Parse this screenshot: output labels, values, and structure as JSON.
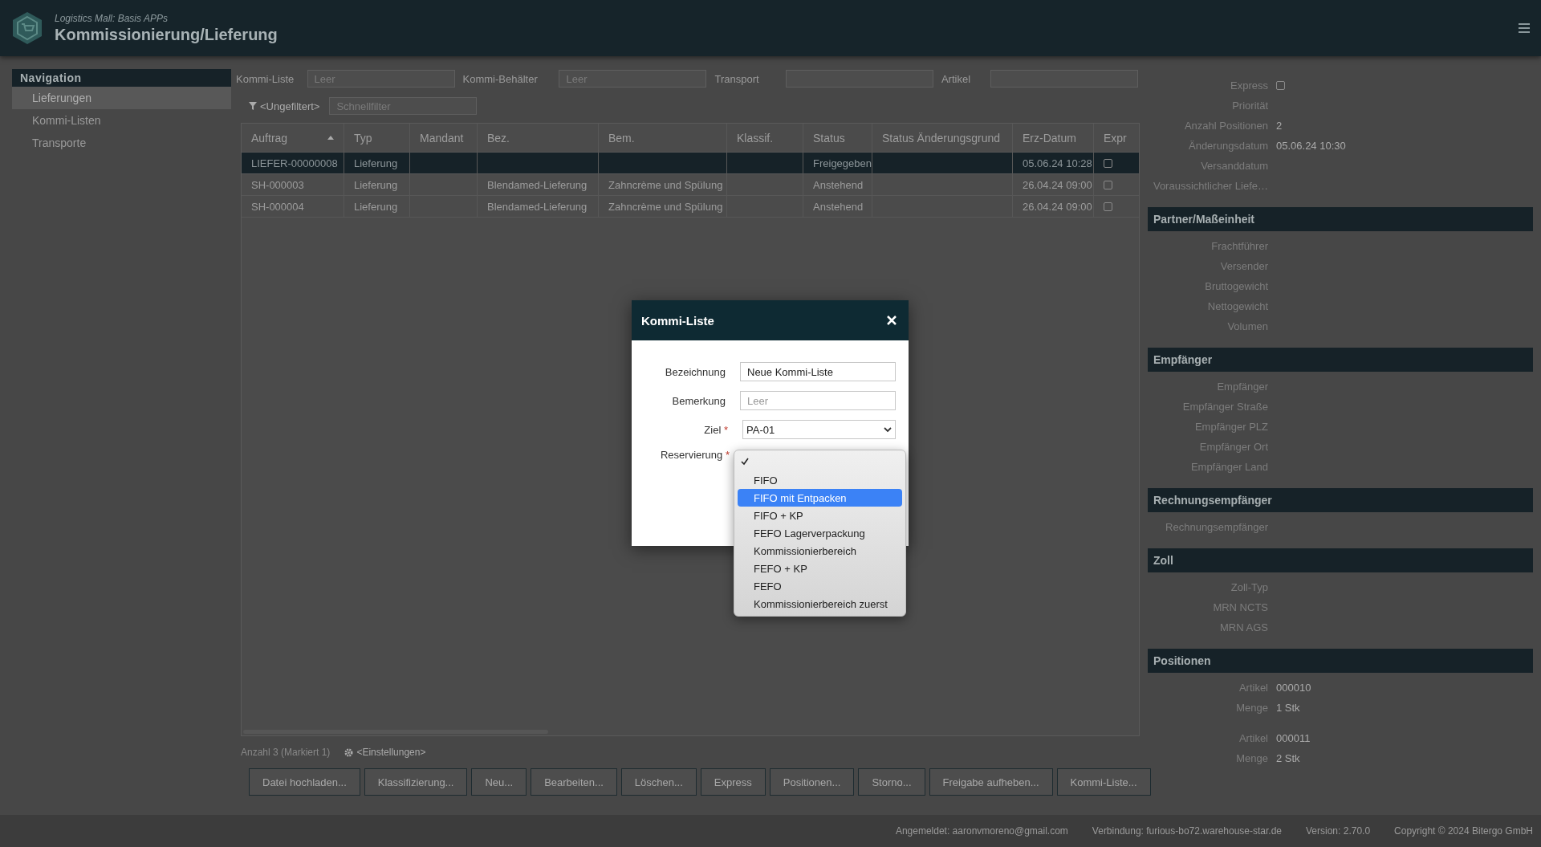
{
  "header": {
    "subtitle": "Logistics Mall: Basis APPs",
    "title": "Kommissionierung/Lieferung"
  },
  "navigation": {
    "title": "Navigation",
    "items": [
      {
        "label": "Lieferungen",
        "selected": true
      },
      {
        "label": "Kommi-Listen",
        "selected": false
      },
      {
        "label": "Transporte",
        "selected": false
      }
    ]
  },
  "filters": [
    {
      "label": "Kommi-Liste",
      "placeholder": "Leer"
    },
    {
      "label": "Kommi-Behälter",
      "placeholder": "Leer"
    },
    {
      "label": "Transport"
    },
    {
      "label": "Artikel"
    }
  ],
  "filter_button": "<Ungefiltert>",
  "quick_filter": {
    "placeholder": "Schnellfilter"
  },
  "table": {
    "columns": [
      {
        "label": "Auftrag",
        "sorted": true
      },
      {
        "label": "Typ",
        "sorted": false
      },
      {
        "label": "Mandant",
        "sorted": false
      },
      {
        "label": "Bez.",
        "sorted": false
      },
      {
        "label": "Bem.",
        "sorted": false
      },
      {
        "label": "Klassif.",
        "sorted": false
      },
      {
        "label": "Status",
        "sorted": false
      },
      {
        "label": "Status Änderungsgrund",
        "sorted": false
      },
      {
        "label": "Erz-Datum",
        "sorted": false
      },
      {
        "label": "Expr",
        "sorted": false
      }
    ],
    "rows": [
      {
        "selected": true,
        "cells": [
          "LIEFER-00000008",
          "Lieferung",
          "",
          "",
          "",
          "",
          "Freigegeben",
          "",
          "05.06.24 10:28"
        ],
        "express": false
      },
      {
        "selected": false,
        "cells": [
          "SH-000003",
          "Lieferung",
          "",
          "Blendamed-Lieferung",
          "Zahncrème und Spülung",
          "",
          "Anstehend",
          "",
          "26.04.24 09:00"
        ],
        "express": false
      },
      {
        "selected": false,
        "cells": [
          "SH-000004",
          "Lieferung",
          "",
          "Blendamed-Lieferung",
          "Zahncrème und Spülung",
          "",
          "Anstehend",
          "",
          "26.04.24 09:00"
        ],
        "express": false
      }
    ]
  },
  "count": "Anzahl 3 (Markiert 1)",
  "settings": "<Einstellungen>",
  "buttons": [
    "Datei hochladen...",
    "Klassifizierung...",
    "Neu...",
    "Bearbeiten...",
    "Löschen...",
    "Express",
    "Positionen...",
    "Storno...",
    "Freigabe aufheben...",
    "Kommi-Liste..."
  ],
  "details": [
    {
      "kind": "rows",
      "rows": [
        {
          "label": "Express",
          "kind": "checkbox",
          "checked": false
        },
        {
          "label": "Priorität"
        },
        {
          "label": "Anzahl Positionen",
          "value": "2"
        },
        {
          "label": "Änderungsdatum",
          "value": "05.06.24 10:30"
        },
        {
          "label": "Versanddatum"
        },
        {
          "label": "Voraussichtlicher Liefe…"
        }
      ]
    },
    {
      "kind": "section",
      "title": "Partner/Maßeinheit",
      "rows": [
        {
          "label": "Frachtführer"
        },
        {
          "label": "Versender"
        },
        {
          "label": "Bruttogewicht"
        },
        {
          "label": "Nettogewicht"
        },
        {
          "label": "Volumen"
        }
      ]
    },
    {
      "kind": "section",
      "title": "Empfänger",
      "rows": [
        {
          "label": "Empfänger"
        },
        {
          "label": "Empfänger Straße"
        },
        {
          "label": "Empfänger PLZ"
        },
        {
          "label": "Empfänger Ort"
        },
        {
          "label": "Empfänger Land"
        }
      ]
    },
    {
      "kind": "section",
      "title": "Rechnungsempfänger",
      "rows": [
        {
          "label": "Rechnungsempfänger"
        }
      ]
    },
    {
      "kind": "section",
      "title": "Zoll",
      "rows": [
        {
          "label": "Zoll-Typ"
        },
        {
          "label": "MRN NCTS"
        },
        {
          "label": "MRN AGS"
        }
      ]
    },
    {
      "kind": "section",
      "title": "Positionen",
      "groups": [
        {
          "rows": [
            {
              "label": "Artikel",
              "value": "000010"
            },
            {
              "label": "Menge",
              "value": "1 Stk"
            }
          ]
        },
        {
          "rows": [
            {
              "label": "Artikel",
              "value": "000011"
            },
            {
              "label": "Menge",
              "value": "2 Stk"
            }
          ]
        }
      ]
    }
  ],
  "status_bar": [
    "Angemeldet: aaronvmoreno@gmail.com",
    "Verbindung: furious-bo72.warehouse-star.de",
    "Version: 2.70.0",
    "Copyright © 2024 Bitergo GmbH"
  ],
  "dialog": {
    "title": "Kommi-Liste",
    "required_mark": "*",
    "fields": [
      {
        "label": "Bezeichnung",
        "kind": "text",
        "value": "Neue Kommi-Liste",
        "required": false
      },
      {
        "label": "Bemerkung",
        "kind": "text",
        "placeholder": "Leer",
        "required": false
      },
      {
        "label": "Ziel",
        "kind": "select",
        "value": "PA-01",
        "required": true
      },
      {
        "label": "Reservierung",
        "kind": "open-select",
        "required": true
      }
    ],
    "options": [
      {
        "checked": true,
        "selected": false
      },
      {
        "label": "FIFO",
        "checked": false,
        "selected": false
      },
      {
        "label": "FIFO mit Entpacken",
        "checked": false,
        "selected": true
      },
      {
        "label": "FIFO + KP",
        "checked": false,
        "selected": false
      },
      {
        "label": "FEFO Lagerverpackung",
        "checked": false,
        "selected": false
      },
      {
        "label": "Kommissionierbereich",
        "checked": false,
        "selected": false
      },
      {
        "label": "FEFO + KP",
        "checked": false,
        "selected": false
      },
      {
        "label": "FEFO",
        "checked": false,
        "selected": false
      },
      {
        "label": "Kommissionierbereich zuerst",
        "checked": false,
        "selected": false
      }
    ]
  }
}
